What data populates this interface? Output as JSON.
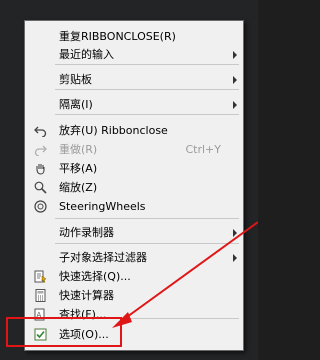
{
  "menu": {
    "items": [
      {
        "label": "重复RIBBONCLOSE(R)",
        "shortcut": "",
        "submenu": false,
        "disabled": false,
        "icon": ""
      },
      {
        "label": "最近的输入",
        "shortcut": "",
        "submenu": true,
        "disabled": false,
        "icon": ""
      },
      {
        "label": "剪贴板",
        "shortcut": "",
        "submenu": true,
        "disabled": false,
        "icon": ""
      },
      {
        "label": "隔离(I)",
        "shortcut": "",
        "submenu": true,
        "disabled": false,
        "icon": ""
      },
      {
        "label": "放弃(U) Ribbonclose",
        "shortcut": "",
        "submenu": false,
        "disabled": false,
        "icon": "undo-icon"
      },
      {
        "label": "重做(R)",
        "shortcut": "Ctrl+Y",
        "submenu": false,
        "disabled": true,
        "icon": "redo-icon"
      },
      {
        "label": "平移(A)",
        "shortcut": "",
        "submenu": false,
        "disabled": false,
        "icon": "pan-hand-icon"
      },
      {
        "label": "缩放(Z)",
        "shortcut": "",
        "submenu": false,
        "disabled": false,
        "icon": "zoom-magnifier-icon"
      },
      {
        "label": "SteeringWheels",
        "shortcut": "",
        "submenu": false,
        "disabled": false,
        "icon": "steering-wheel-icon"
      },
      {
        "label": "动作录制器",
        "shortcut": "",
        "submenu": true,
        "disabled": false,
        "icon": ""
      },
      {
        "label": "子对象选择过滤器",
        "shortcut": "",
        "submenu": true,
        "disabled": false,
        "icon": ""
      },
      {
        "label": "快速选择(Q)...",
        "shortcut": "",
        "submenu": false,
        "disabled": false,
        "icon": "quick-select-icon"
      },
      {
        "label": "快速计算器",
        "shortcut": "",
        "submenu": false,
        "disabled": false,
        "icon": "calculator-icon"
      },
      {
        "label": "查找(F)...",
        "shortcut": "",
        "submenu": false,
        "disabled": false,
        "icon": "find-icon"
      },
      {
        "label": "选项(O)...",
        "shortcut": "",
        "submenu": false,
        "disabled": false,
        "icon": "options-check-icon"
      }
    ]
  },
  "annotation": {
    "highlight_color": "#e01616",
    "highlighted_item": "选项(O)..."
  }
}
